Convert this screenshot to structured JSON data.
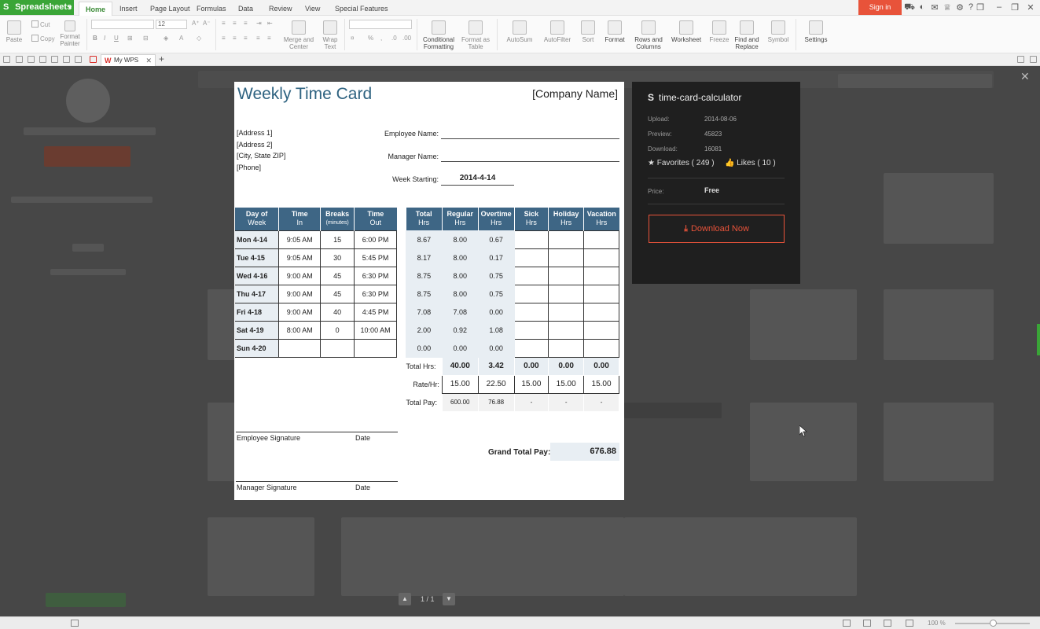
{
  "app": {
    "name": "Spreadsheets",
    "sign_in": "Sign in"
  },
  "menu_tabs": [
    "Home",
    "Insert",
    "Page Layout",
    "Formulas",
    "Data",
    "Review",
    "View",
    "Special Features"
  ],
  "ribbon": {
    "paste": "Paste",
    "cut": "Cut",
    "copy": "Copy",
    "format_painter_1": "Format",
    "format_painter_2": "Painter",
    "font_size": "12",
    "merge_1": "Merge and",
    "merge_2": "Center",
    "wrap_1": "Wrap",
    "wrap_2": "Text",
    "cond_1": "Conditional",
    "cond_2": "Formatting",
    "fmt_table_1": "Format as",
    "fmt_table_2": "Table",
    "autosum": "AutoSum",
    "autofilter": "AutoFilter",
    "sort": "Sort",
    "format": "Format",
    "rows_cols_1": "Rows and",
    "rows_cols_2": "Columns",
    "worksheet": "Worksheet",
    "freeze": "Freeze",
    "find_1": "Find and",
    "find_2": "Replace",
    "symbol": "Symbol",
    "settings": "Settings"
  },
  "doc_tab": {
    "label": "My WPS"
  },
  "sheet": {
    "title": "Weekly Time Card",
    "company": "[Company Name]",
    "address": [
      "[Address 1]",
      "[Address 2]",
      "[City, State  ZIP]",
      "[Phone]"
    ],
    "employee_name_label": "Employee Name:",
    "manager_name_label": "Manager Name:",
    "week_starting_label": "Week Starting:",
    "week_starting_value": "2014-4-14",
    "left_headers": [
      {
        "main": "Day of",
        "sub": "Week"
      },
      {
        "main": "Time",
        "sub": "In"
      },
      {
        "main": "Breaks",
        "sub": "(minutes)"
      },
      {
        "main": "Time",
        "sub": "Out"
      }
    ],
    "right_headers": [
      {
        "main": "Total",
        "sub": "Hrs"
      },
      {
        "main": "Regular",
        "sub": "Hrs"
      },
      {
        "main": "Overtime",
        "sub": "Hrs"
      },
      {
        "main": "Sick",
        "sub": "Hrs"
      },
      {
        "main": "Holiday",
        "sub": "Hrs"
      },
      {
        "main": "Vacation",
        "sub": "Hrs"
      }
    ],
    "days": [
      {
        "day": "Mon 4-14",
        "in": "9:05 AM",
        "breaks": "15",
        "out": "6:00 PM",
        "total": "8.67",
        "regular": "8.00",
        "overtime": "0.67"
      },
      {
        "day": "Tue 4-15",
        "in": "9:05 AM",
        "breaks": "30",
        "out": "5:45 PM",
        "total": "8.17",
        "regular": "8.00",
        "overtime": "0.17"
      },
      {
        "day": "Wed 4-16",
        "in": "9:00 AM",
        "breaks": "45",
        "out": "6:30 PM",
        "total": "8.75",
        "regular": "8.00",
        "overtime": "0.75"
      },
      {
        "day": "Thu 4-17",
        "in": "9:00 AM",
        "breaks": "45",
        "out": "6:30 PM",
        "total": "8.75",
        "regular": "8.00",
        "overtime": "0.75"
      },
      {
        "day": "Fri 4-18",
        "in": "9:00 AM",
        "breaks": "40",
        "out": "4:45 PM",
        "total": "7.08",
        "regular": "7.08",
        "overtime": "0.00"
      },
      {
        "day": "Sat 4-19",
        "in": "8:00 AM",
        "breaks": "0",
        "out": "10:00 AM",
        "total": "2.00",
        "regular": "0.92",
        "overtime": "1.08"
      },
      {
        "day": "Sun 4-20",
        "in": "",
        "breaks": "",
        "out": "",
        "total": "0.00",
        "regular": "0.00",
        "overtime": "0.00"
      }
    ],
    "total_hrs_label": "Total Hrs:",
    "total_hrs": [
      "40.00",
      "3.42",
      "0.00",
      "0.00",
      "0.00"
    ],
    "rate_label": "Rate/Hr:",
    "rates": [
      "15.00",
      "22.50",
      "15.00",
      "15.00",
      "15.00"
    ],
    "total_pay_label": "Total Pay:",
    "total_pay": [
      "600.00",
      "76.88",
      "-",
      "-",
      "-"
    ],
    "employee_signature": "Employee Signature",
    "manager_signature": "Manager Signature",
    "date_label": "Date",
    "grand_total_label": "Grand Total Pay:",
    "grand_total_value": "676.88"
  },
  "panel": {
    "logo": "S",
    "title": "time-card-calculator",
    "upload_label": "Upload:",
    "upload_value": "2014-08-06",
    "preview_label": "Preview:",
    "preview_value": "45823",
    "download_label": "Download:",
    "download_value": "16081",
    "favorites": "Favorites ( 249 )",
    "likes": "Likes ( 10 )",
    "price_label": "Price:",
    "price_value": "Free",
    "download_button": "Download Now"
  },
  "pager": {
    "text": "1 / 1"
  },
  "status": {
    "zoom": "100 %"
  },
  "colors": {
    "accent_green": "#3aa537",
    "sign_in": "#e8533a",
    "header_blue": "#3e6685",
    "title_blue": "#2f6381"
  }
}
